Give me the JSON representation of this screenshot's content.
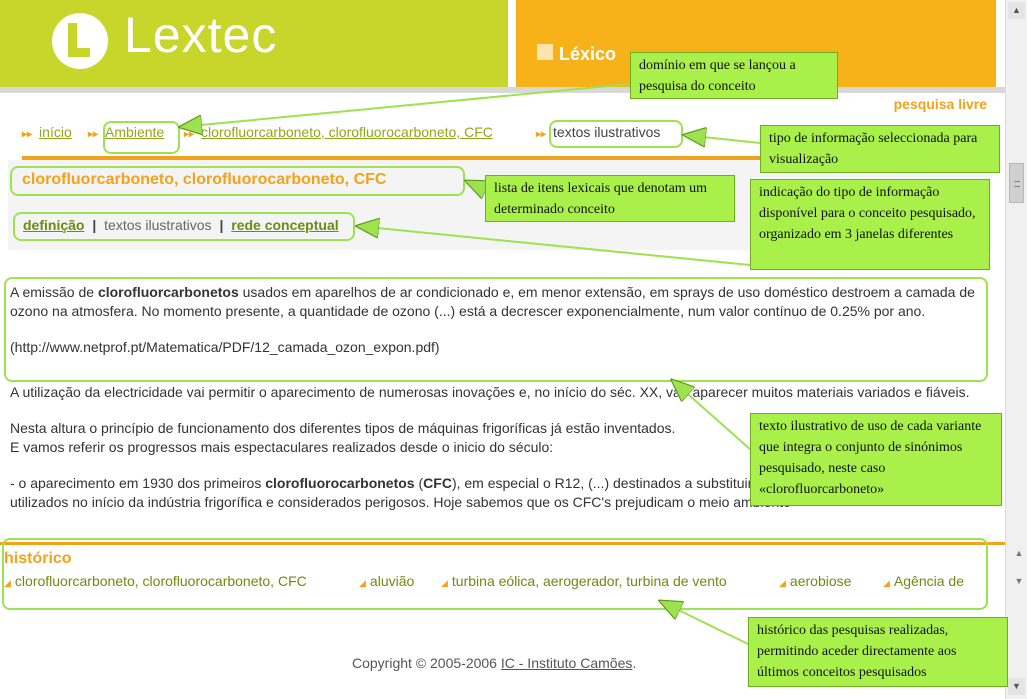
{
  "header": {
    "logo_text": "Lextec",
    "section_label": "Léxico",
    "search_link": "pesquisa livre"
  },
  "breadcrumb": [
    {
      "label": "início"
    },
    {
      "label": "Ambiente"
    },
    {
      "label": "clorofluorcarboneto, clorofluorocarboneto, CFC"
    },
    {
      "label": "textos ilustrativos"
    }
  ],
  "concept": {
    "title": "clorofluorcarboneto, clorofluorocarboneto, CFC"
  },
  "tabs": {
    "definition": "definição",
    "texts": "textos ilustrativos",
    "network": "rede conceptual",
    "separator": "|"
  },
  "texts": {
    "p1_before": "A emissão de ",
    "p1_bold": "clorofluorcarbonetos",
    "p1_after": " usados em aparelhos de ar condicionado e, em menor extensão, em sprays de uso doméstico destroem a camada de ozono na atmosfera. No momento presente, a quantidade de ozono (...) está a decrescer exponencialmente, num valor contínuo de 0.25% por ano.",
    "p1_source": "(http://www.netprof.pt/Matematica/PDF/12_camada_ozon_expon.pdf)",
    "p2": "A utilização da electricidade vai permitir o aparecimento de numerosas inovações e, no início do séc. XX, vão aparecer muitos materiais variados e fiáveis.",
    "p3_line1": "Nesta altura o princípio de funcionamento dos diferentes tipos de máquinas frigoríficas já estão inventados.",
    "p3_line2": "E vamos referir os progressos mais espectaculares realizados desde o inicio do século:",
    "p4_before": "- o aparecimento em 1930 dos primeiros ",
    "p4_bold": "clorofluorocarbonetos",
    "p4_mid": " (",
    "p4_bold2": "CFC",
    "p4_after": "), em especial o R12, (...) destinados a substituir o éter sulfuroso e o éter metílico utilizados no início da indústria frigorífica e considerados perigosos. Hoje sabemos que os CFC's prejudicam o meio ambiente"
  },
  "history": {
    "title": "histórico",
    "items": [
      "clorofluorcarboneto, clorofluorocarboneto, CFC",
      "aluvião",
      "turbina eólica, aerogerador, turbina de vento",
      "aerobiose",
      "Agência de"
    ]
  },
  "footer": {
    "copyright": "Copyright © 2005-2006",
    "institute": "IC - Instituto Camões",
    "period": "."
  },
  "callouts": {
    "domain": "domínio em que se lançou a pesquisa do conceito",
    "info_type": "tipo de informação seleccionada para visualização",
    "lexical_items": "lista de itens lexicais que denotam um determinado conceito",
    "windows": "indicação do tipo de informação disponível para o conceito pesquisado, organizado em 3 janelas diferentes",
    "illustrative": "texto ilustrativo de uso de cada variante que integra o conjunto de sinónimos pesquisado, neste caso «clorofluorcarboneto»",
    "history": "histórico das pesquisas realizadas, permitindo aceder directamente aos últimos conceitos pesquisados"
  },
  "colors": {
    "header_green": "#c8d62b",
    "header_orange": "#f7b21a",
    "accent_orange": "#f2a21b",
    "link_green": "#8fa81a",
    "callout_green": "#aaf04b"
  }
}
